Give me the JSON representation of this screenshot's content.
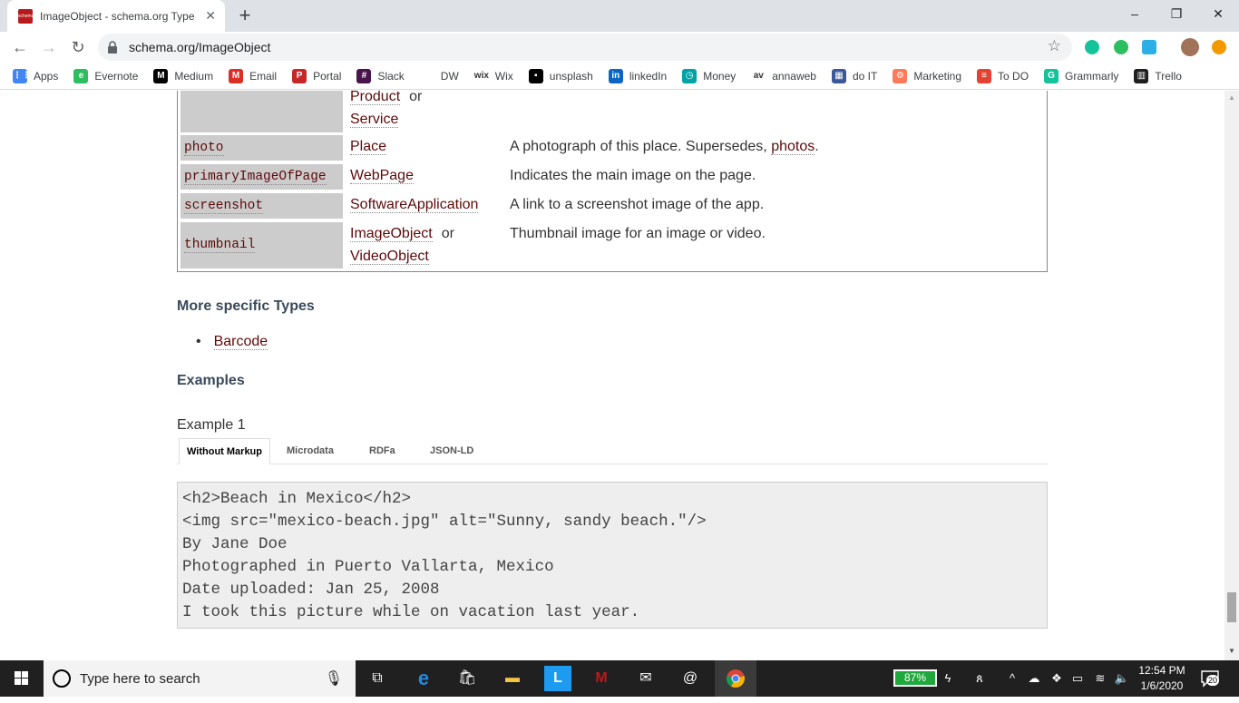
{
  "browser": {
    "tab_title": "ImageObject - schema.org Type",
    "tab_favicon_text": "schema.org",
    "url": "schema.org/ImageObject",
    "window_controls": {
      "minimize": "–",
      "restore": "❐",
      "close": "✕"
    },
    "new_tab": "+",
    "tab_close": "✕",
    "nav": {
      "back": "←",
      "forward": "→",
      "reload": "↻"
    }
  },
  "bookmarks": [
    {
      "label": "Apps",
      "icon": "apps-grid-icon",
      "color": "#4285f4",
      "glyph": "⋮⋮"
    },
    {
      "label": "Evernote",
      "icon": "evernote-icon",
      "color": "#2dbe60",
      "glyph": "e"
    },
    {
      "label": "Medium",
      "icon": "medium-icon",
      "color": "#000000",
      "glyph": "M"
    },
    {
      "label": "Email",
      "icon": "gmail-icon",
      "color": "#d93025",
      "glyph": "M"
    },
    {
      "label": "Portal",
      "icon": "portal-icon",
      "color": "#c62828",
      "glyph": "P"
    },
    {
      "label": "Slack",
      "icon": "slack-icon",
      "color": "#4a154b",
      "glyph": "#"
    },
    {
      "label": "DW",
      "icon": "dw-icon",
      "color": "#ffffff",
      "glyph": ""
    },
    {
      "label": "Wix",
      "icon": "wix-icon",
      "color": "#ffffff",
      "glyph": "wix"
    },
    {
      "label": "unsplash",
      "icon": "unsplash-icon",
      "color": "#000000",
      "glyph": "▪"
    },
    {
      "label": "linkedIn",
      "icon": "linkedin-icon",
      "color": "#0a66c2",
      "glyph": "in"
    },
    {
      "label": "Money",
      "icon": "money-icon",
      "color": "#00a4a6",
      "glyph": "◷"
    },
    {
      "label": "annaweb",
      "icon": "annaweb-icon",
      "color": "#ffffff",
      "glyph": "av"
    },
    {
      "label": "do IT",
      "icon": "doit-grid-icon",
      "color": "#3b5998",
      "glyph": "▦"
    },
    {
      "label": "Marketing",
      "icon": "hubspot-icon",
      "color": "#ff7a59",
      "glyph": "⚙"
    },
    {
      "label": "To DO",
      "icon": "todoist-icon",
      "color": "#e44332",
      "glyph": "≡"
    },
    {
      "label": "Grammarly",
      "icon": "grammarly-icon",
      "color": "#15c39a",
      "glyph": "G"
    },
    {
      "label": "Trello",
      "icon": "trello-icon",
      "color": "#1f1f1f",
      "glyph": "▥"
    }
  ],
  "properties": [
    {
      "prop": "",
      "types": [
        "Product",
        "Service"
      ],
      "desc": ""
    },
    {
      "prop": "photo",
      "types": [
        "Place"
      ],
      "desc": "A photograph of this place. Supersedes, ",
      "desc_link": "photos",
      "desc_end": "."
    },
    {
      "prop": "primaryImageOfPage",
      "types": [
        "WebPage"
      ],
      "desc": "Indicates the main image on the page."
    },
    {
      "prop": "screenshot",
      "types": [
        "SoftwareApplication"
      ],
      "desc": "A link to a screenshot image of the app."
    },
    {
      "prop": "thumbnail",
      "types": [
        "ImageObject",
        "VideoObject"
      ],
      "desc": "Thumbnail image for an image or video."
    }
  ],
  "or_word": "or",
  "more_specific": {
    "heading": "More specific Types",
    "items": [
      "Barcode"
    ]
  },
  "examples": {
    "heading": "Examples",
    "label": "Example 1",
    "tabs": [
      "Without Markup",
      "Microdata",
      "RDFa",
      "JSON-LD"
    ],
    "active_tab": "Without Markup",
    "code": [
      "<h2>Beach in Mexico</h2>",
      "<img src=\"mexico-beach.jpg\" alt=\"Sunny, sandy beach.\"/>",
      "By Jane Doe",
      "Photographed in Puerto Vallarta, Mexico",
      "Date uploaded: Jan 25, 2008",
      "I took this picture while on vacation last year."
    ]
  },
  "taskbar": {
    "search_placeholder": "Type here to search",
    "battery": "87%",
    "time": "12:54 PM",
    "date": "1/6/2020",
    "notifications": "20"
  }
}
